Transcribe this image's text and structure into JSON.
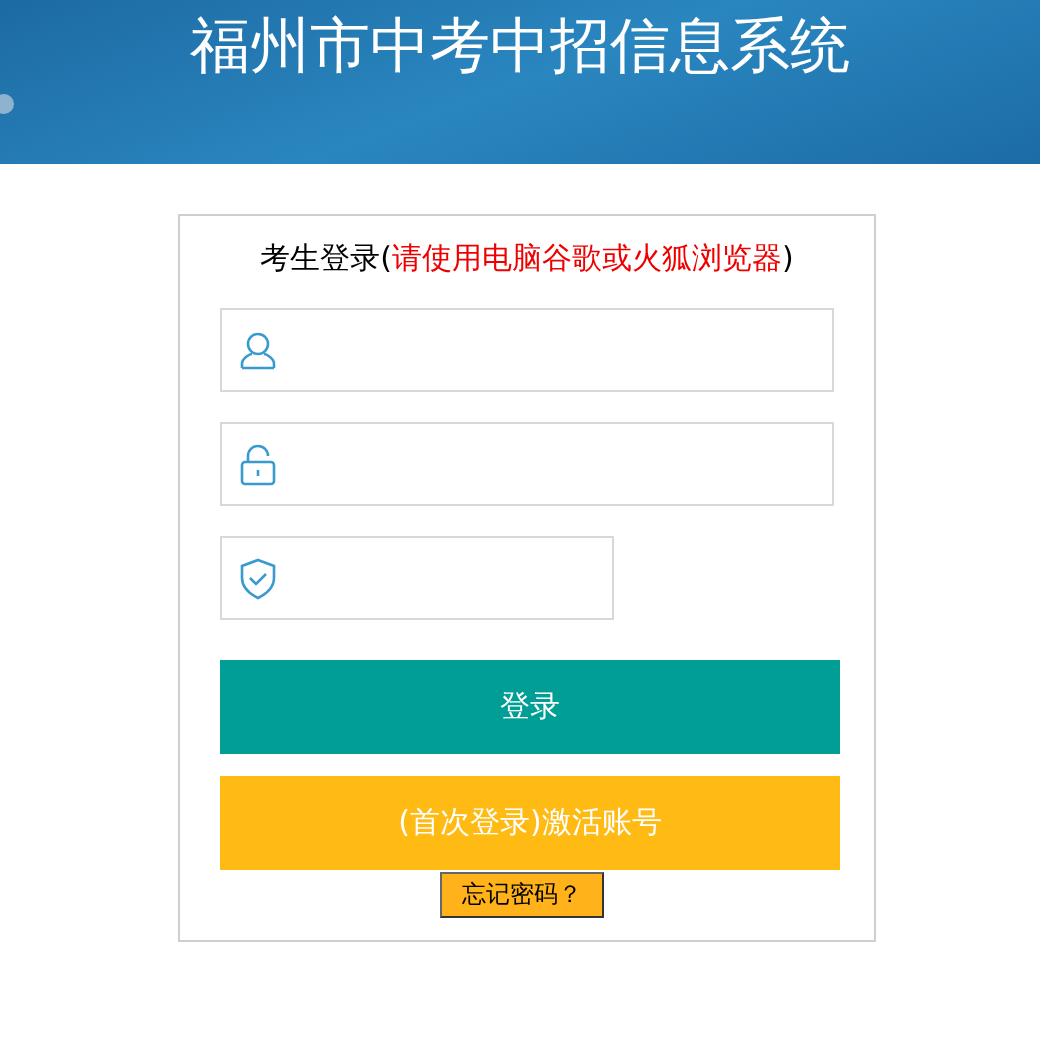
{
  "header": {
    "title": "福州市中考中招信息系统"
  },
  "login": {
    "heading": [
      {
        "text": "考生登录(",
        "color": "#000000"
      },
      {
        "text": "请使用电脑谷歌或火狐浏览器",
        "color": "#ee0000"
      },
      {
        "text": ")",
        "color": "#000000"
      }
    ],
    "fields": [
      {
        "kind": "user"
      },
      {
        "kind": "lock"
      },
      {
        "kind": "shield"
      }
    ],
    "buttons": [
      {
        "label": "登录",
        "kind": "primary"
      },
      {
        "label": "(首次登录)激活账号",
        "kind": "activate"
      }
    ],
    "forgot": "忘记密码？"
  }
}
